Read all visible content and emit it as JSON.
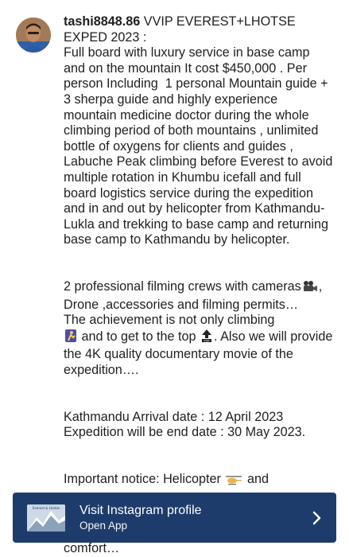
{
  "post": {
    "username": "tashi8848.86",
    "paragraphs": [
      " VVIP EVEREST+LHOTSE EXPED 2023 :\nFull board with luxury service in base camp and on the mountain It cost $450,000 . Per person Including  1 personal Mountain guide + 3 sherpa guide and highly experience mountain medicine doctor during the whole climbing period of both mountains , unlimited bottle of oxygens for clients and guides , Labuche Peak climbing before Everest to avoid multiple rotation in Khumbu icefall and full board logistics service during the expedition and in and out by helicopter from Kathmandu-Lukla and trekking to base camp and returning base camp to Kathmandu by helicopter."
    ],
    "filming_a": "2 professional filming crews with cameras",
    "filming_b": ", Drone ,accessories and filming permits…",
    "achieve_a": "The achievement is not only climbing",
    "achieve_b": " and to get to the top ",
    "achieve_c": ". Also we will provide the 4K quality documentary movie of the expedition….",
    "arrival": "Kathmandu Arrival date : 12 April 2023",
    "end_date": "Expedition will be end date : 30 May 2023.",
    "notice_a": "Important notice: Helicopter ",
    "notice_b": " and",
    "tail": "comfort…"
  },
  "banner": {
    "title": "Visit Instagram profile",
    "subtitle": "Open App",
    "thumb_caption": "Everest & Lhotse",
    "color": "#1e3c6b"
  },
  "icons": [
    "movie-camera-icon",
    "climber-icon",
    "top-arrow-icon",
    "helicopter-icon",
    "chevron-right-icon"
  ]
}
